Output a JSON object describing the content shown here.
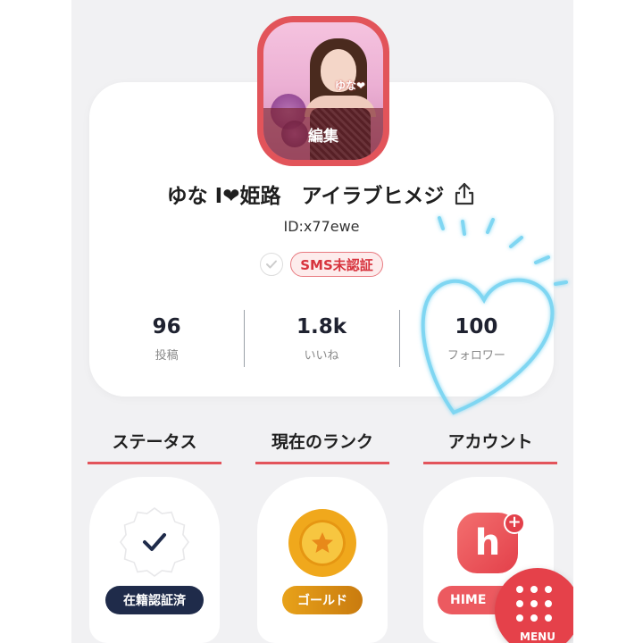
{
  "profile": {
    "avatar_edit_label": "編集",
    "avatar_tag": "ゆな❤",
    "name": "ゆな I❤姫路　アイラブヒメジ",
    "user_id": "ID:x77ewe",
    "sms_badge": "SMS未認証"
  },
  "stats": [
    {
      "value": "96",
      "label": "投稿"
    },
    {
      "value": "1.8k",
      "label": "いいね"
    },
    {
      "value": "100",
      "label": "フォロワー"
    }
  ],
  "sections": [
    {
      "title": "ステータス",
      "badge": "在籍認証済"
    },
    {
      "title": "現在のランク",
      "badge": "ゴールド"
    },
    {
      "title": "アカウント",
      "badge": "HIME"
    }
  ],
  "menu": {
    "label": "MENU"
  },
  "colors": {
    "accent": "#e3545b",
    "status_pill": "#1f2b4a",
    "gold": "#f0a81c",
    "sms_text": "#d7333d"
  }
}
